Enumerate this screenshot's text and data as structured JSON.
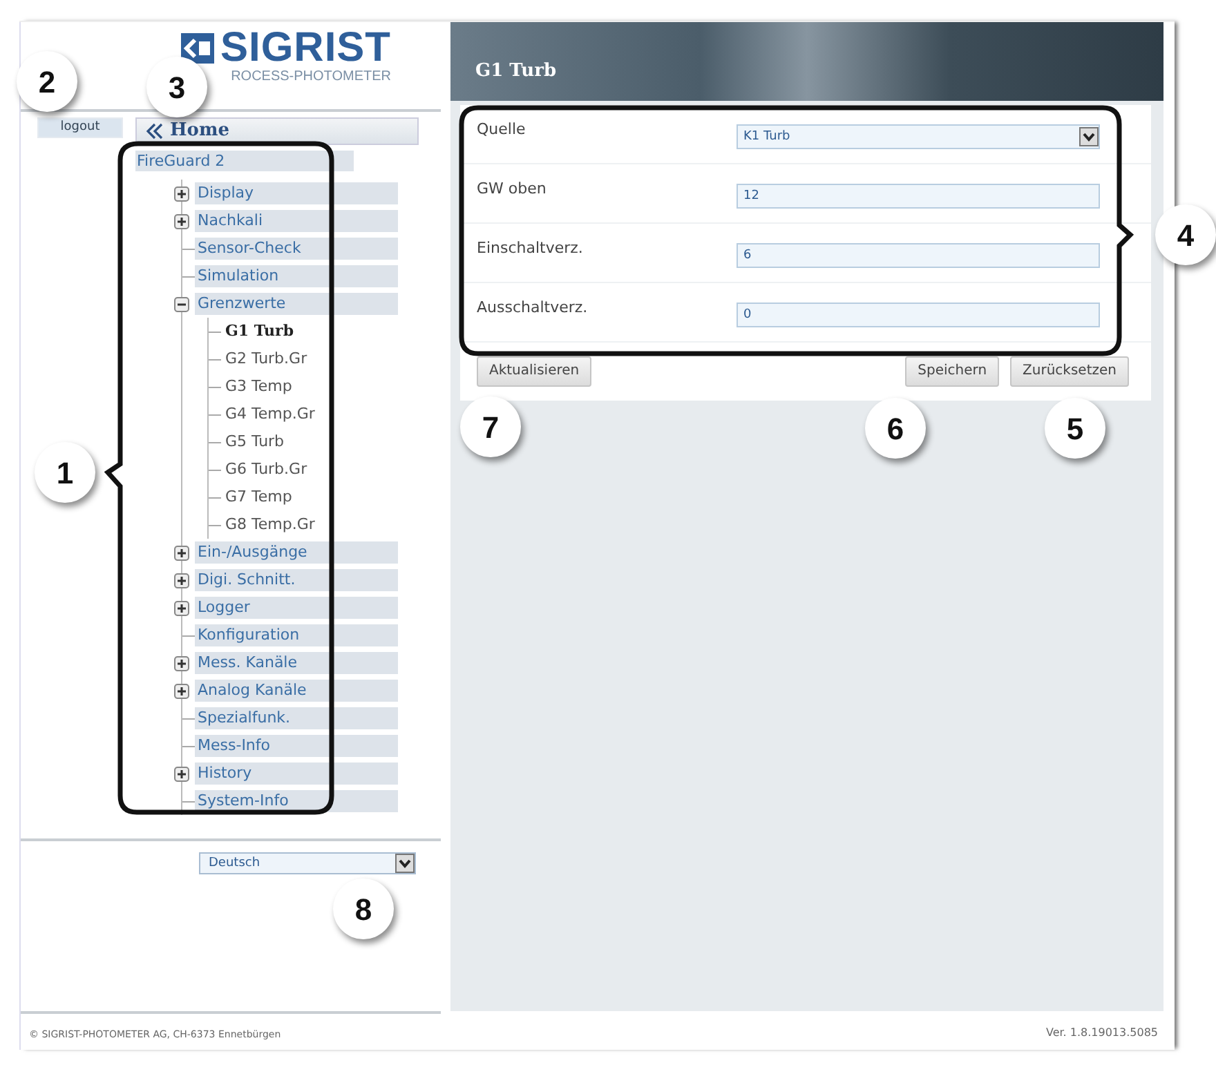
{
  "logo": {
    "name": "SIGRIST",
    "tagline": "ROCESS-PHOTOMETER"
  },
  "logout": "logout",
  "home": "Home",
  "tree": {
    "label": "FireGuard 2",
    "children": [
      {
        "label": "Display",
        "kind": "folder",
        "expanded": false
      },
      {
        "label": "Nachkali",
        "kind": "folder",
        "expanded": false
      },
      {
        "label": "Sensor-Check",
        "kind": "leaf"
      },
      {
        "label": "Simulation",
        "kind": "leaf"
      },
      {
        "label": "Grenzwerte",
        "kind": "folder",
        "expanded": true,
        "children": [
          {
            "label": "G1 Turb",
            "selected": true
          },
          {
            "label": "G2 Turb.Gr",
            "selected": false
          },
          {
            "label": "G3 Temp",
            "selected": false
          },
          {
            "label": "G4 Temp.Gr",
            "selected": false
          },
          {
            "label": "G5 Turb",
            "selected": false
          },
          {
            "label": "G6 Turb.Gr",
            "selected": false
          },
          {
            "label": "G7 Temp",
            "selected": false
          },
          {
            "label": "G8 Temp.Gr",
            "selected": false
          }
        ]
      },
      {
        "label": "Ein-/Ausgänge",
        "kind": "folder",
        "expanded": false
      },
      {
        "label": "Digi. Schnitt.",
        "kind": "folder",
        "expanded": false
      },
      {
        "label": "Logger",
        "kind": "folder",
        "expanded": false
      },
      {
        "label": "Konfiguration",
        "kind": "leaf"
      },
      {
        "label": "Mess. Kanäle",
        "kind": "folder",
        "expanded": false
      },
      {
        "label": "Analog Kanäle",
        "kind": "folder",
        "expanded": false
      },
      {
        "label": "Spezialfunk.",
        "kind": "leaf"
      },
      {
        "label": "Mess-Info",
        "kind": "leaf"
      },
      {
        "label": "History",
        "kind": "folder",
        "expanded": false
      },
      {
        "label": "System-Info",
        "kind": "leaf"
      }
    ]
  },
  "language": "Deutsch",
  "copyright": "© SIGRIST-PHOTOMETER AG, CH-6373 Ennetbürgen",
  "panel": {
    "title": "G1 Turb",
    "fields": [
      {
        "label": "Quelle",
        "kind": "select",
        "value": "K1 Turb"
      },
      {
        "label": "GW oben",
        "kind": "input",
        "value": "12"
      },
      {
        "label": "Einschaltverz.",
        "kind": "input",
        "value": "6"
      },
      {
        "label": "Ausschaltverz.",
        "kind": "input",
        "value": "0"
      }
    ],
    "buttons_left": [
      "Aktualisieren"
    ],
    "buttons_right": [
      "Speichern",
      "Zurücksetzen"
    ]
  },
  "version": "Ver. 1.8.19013.5085",
  "callouts": [
    {
      "label": "2"
    },
    {
      "label": "3"
    },
    {
      "label": "1"
    },
    {
      "label": "4"
    },
    {
      "label": "7"
    },
    {
      "label": "6"
    },
    {
      "label": "5"
    },
    {
      "label": "8"
    }
  ]
}
